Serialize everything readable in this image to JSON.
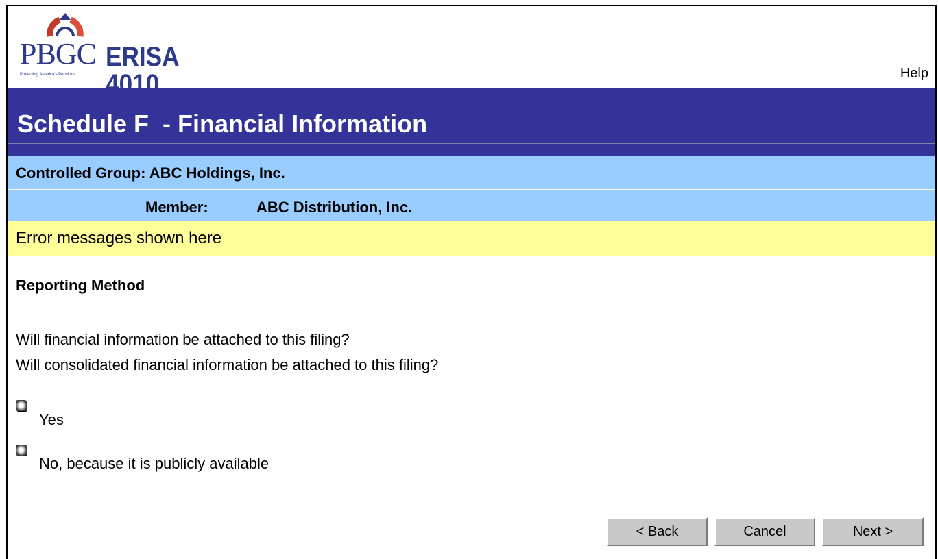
{
  "header": {
    "logo": {
      "brand": "PBGC",
      "product": "ERISA 4010",
      "tagline": "Protecting America's Pensions",
      "arc_colors": [
        "#c0392b",
        "#2d3a8c",
        "#d94f3a"
      ]
    },
    "help_label": "Help"
  },
  "title_bar": {
    "title": "Schedule F  - Financial Information",
    "background": "#333399"
  },
  "controlled_group": {
    "text": "Controlled Group: ABC Holdings, Inc.",
    "background": "#99ccff"
  },
  "member": {
    "label": "Member:",
    "value": "ABC Distribution, Inc."
  },
  "error_bar": {
    "text": "Error messages shown here",
    "background": "#ffff99"
  },
  "form": {
    "section_title": "Reporting Method",
    "questions": [
      "Will financial information be attached to this filing?",
      "Will consolidated financial information be attached to this filing?"
    ],
    "options": [
      {
        "label": "Yes",
        "selected": false
      },
      {
        "label": "No, because it is publicly available",
        "selected": false
      }
    ]
  },
  "buttons": {
    "back": "< Back",
    "cancel": "Cancel",
    "next": "Next >"
  }
}
